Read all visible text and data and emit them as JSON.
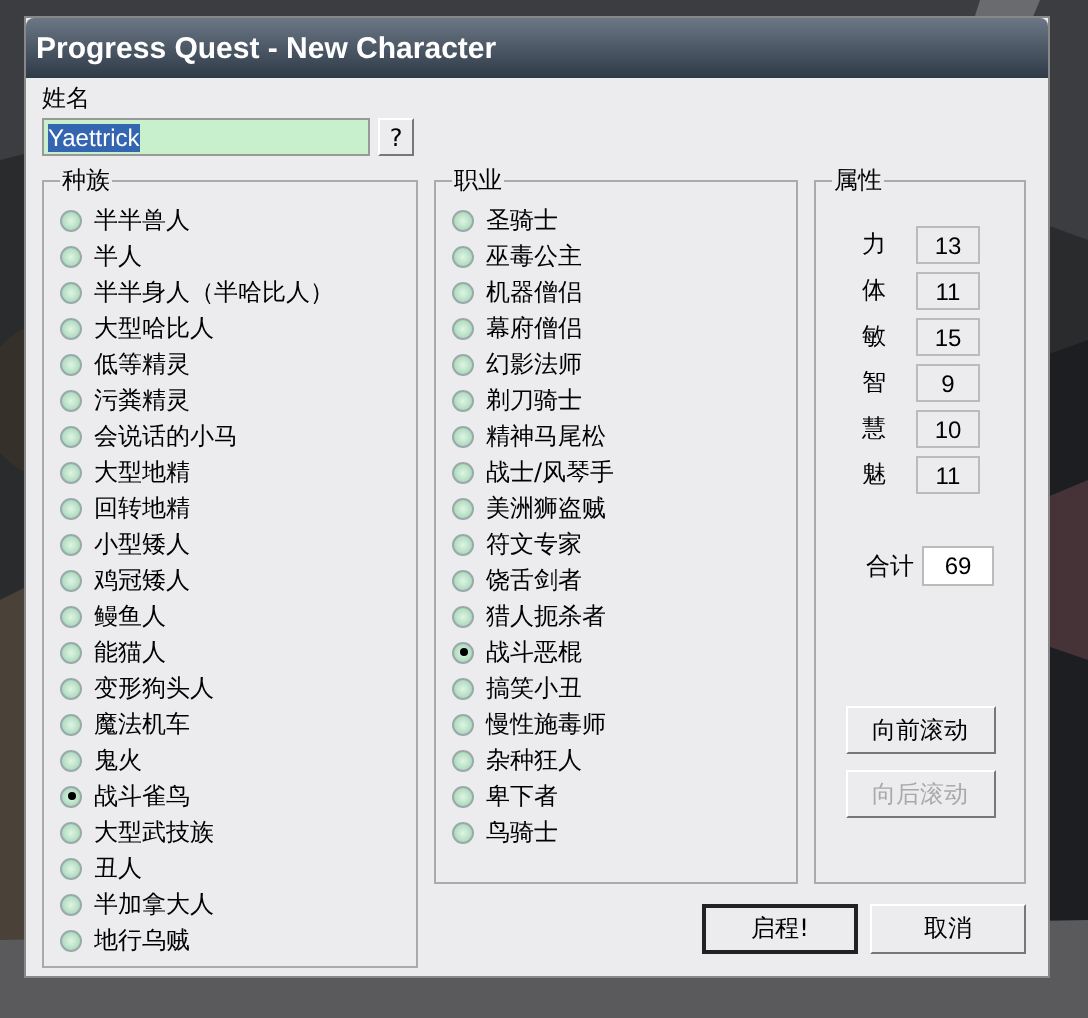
{
  "window": {
    "title": "Progress Quest - New Character"
  },
  "name": {
    "label": "姓名",
    "value": "Yaettrick",
    "value_selected": true,
    "help_button": "?"
  },
  "race": {
    "title": "种族",
    "options": [
      {
        "label": "半半兽人",
        "selected": false
      },
      {
        "label": "半人",
        "selected": false
      },
      {
        "label": "半半身人（半哈比人）",
        "selected": false
      },
      {
        "label": "大型哈比人",
        "selected": false
      },
      {
        "label": "低等精灵",
        "selected": false
      },
      {
        "label": "污粪精灵",
        "selected": false
      },
      {
        "label": "会说话的小马",
        "selected": false
      },
      {
        "label": "大型地精",
        "selected": false
      },
      {
        "label": "回转地精",
        "selected": false
      },
      {
        "label": "小型矮人",
        "selected": false
      },
      {
        "label": "鸡冠矮人",
        "selected": false
      },
      {
        "label": "鳗鱼人",
        "selected": false
      },
      {
        "label": "能猫人",
        "selected": false
      },
      {
        "label": "变形狗头人",
        "selected": false
      },
      {
        "label": "魔法机车",
        "selected": false
      },
      {
        "label": "鬼火",
        "selected": false
      },
      {
        "label": "战斗雀鸟",
        "selected": true
      },
      {
        "label": "大型武技族",
        "selected": false
      },
      {
        "label": "丑人",
        "selected": false
      },
      {
        "label": "半加拿大人",
        "selected": false
      },
      {
        "label": "地行乌贼",
        "selected": false
      }
    ]
  },
  "class": {
    "title": "职业",
    "options": [
      {
        "label": "圣骑士",
        "selected": false
      },
      {
        "label": "巫毒公主",
        "selected": false
      },
      {
        "label": "机器僧侣",
        "selected": false
      },
      {
        "label": "幕府僧侣",
        "selected": false
      },
      {
        "label": "幻影法师",
        "selected": false
      },
      {
        "label": "剃刀骑士",
        "selected": false
      },
      {
        "label": "精神马尾松",
        "selected": false
      },
      {
        "label": "战士/风琴手",
        "selected": false
      },
      {
        "label": "美洲狮盗贼",
        "selected": false
      },
      {
        "label": "符文专家",
        "selected": false
      },
      {
        "label": "饶舌剑者",
        "selected": false
      },
      {
        "label": "猎人扼杀者",
        "selected": false
      },
      {
        "label": "战斗恶棍",
        "selected": true
      },
      {
        "label": "搞笑小丑",
        "selected": false
      },
      {
        "label": "慢性施毒师",
        "selected": false
      },
      {
        "label": "杂种狂人",
        "selected": false
      },
      {
        "label": "卑下者",
        "selected": false
      },
      {
        "label": "鸟骑士",
        "selected": false
      }
    ]
  },
  "stats": {
    "title": "属性",
    "rows": [
      {
        "label": "力",
        "value": "13"
      },
      {
        "label": "体",
        "value": "11"
      },
      {
        "label": "敏",
        "value": "15"
      },
      {
        "label": "智",
        "value": "9"
      },
      {
        "label": "慧",
        "value": "10"
      },
      {
        "label": "魅",
        "value": "11"
      }
    ],
    "total": {
      "label": "合计",
      "value": "69"
    },
    "buttons": [
      {
        "label": "向前滚动",
        "disabled": false
      },
      {
        "label": "向后滚动",
        "disabled": true
      }
    ]
  },
  "buttons": [
    {
      "label": "启程!",
      "default": true
    },
    {
      "label": "取消",
      "default": false
    }
  ]
}
